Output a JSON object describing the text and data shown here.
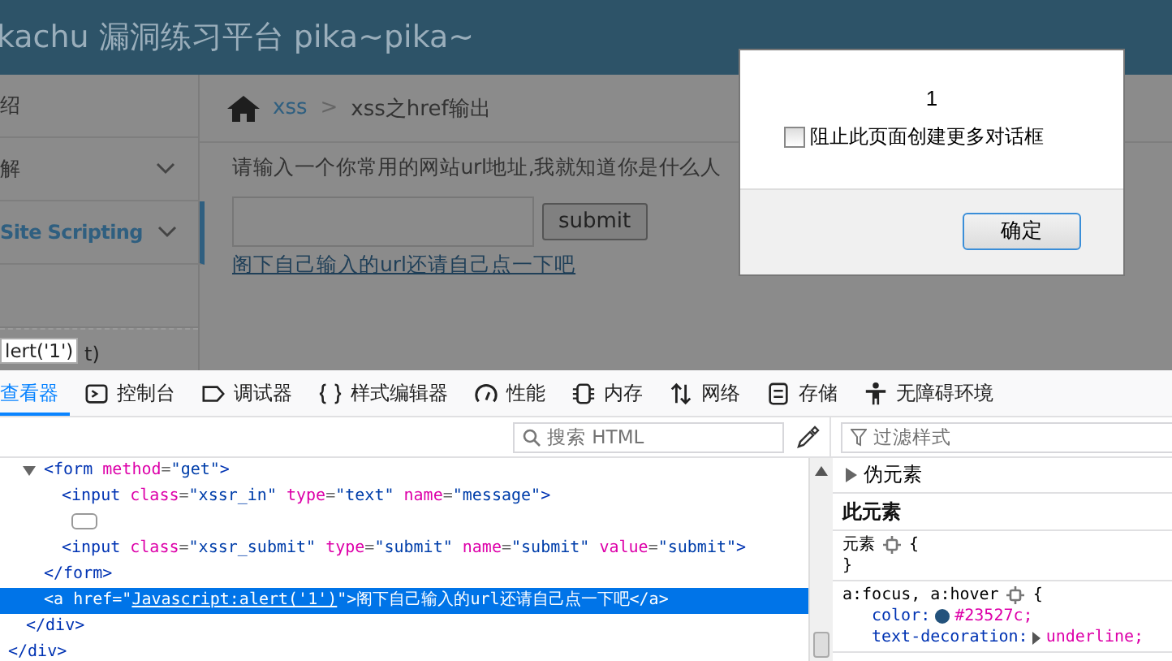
{
  "page": {
    "header_title": "kachu 漏洞练习平台 pika~pika~",
    "sidebar": [
      {
        "label": "绍",
        "kind": "item",
        "selected": false
      },
      {
        "label": "解",
        "kind": "menu",
        "selected": false
      },
      {
        "label": "Site Scripting",
        "kind": "menu",
        "selected": true
      },
      {
        "kind": "item",
        "selected": false
      },
      {
        "label": "t)",
        "kind": "item",
        "selected": false
      }
    ],
    "breadcrumb": {
      "section": "xss",
      "separator": ">",
      "current": "xss之href输出"
    },
    "prompt": "请输入一个你常用的网站url地址,我就知道你是什么人",
    "submit": "submit",
    "link": "阁下自己输入的url还请自己点一下吧"
  },
  "tooltip": "lert('1')",
  "dialog": {
    "message": "1",
    "checkbox": {
      "label": "阻止此页面创建更多对话框",
      "checked": false
    },
    "ok": "确定"
  },
  "devtools": {
    "tabs": [
      {
        "label": "查看器",
        "selected": true
      },
      {
        "label": "控制台",
        "selected": false
      },
      {
        "label": "调试器",
        "selected": false
      },
      {
        "label": "样式编辑器",
        "selected": false
      },
      {
        "label": "性能",
        "selected": false
      },
      {
        "label": "内存",
        "selected": false
      },
      {
        "label": "网络",
        "selected": false
      },
      {
        "label": "存储",
        "selected": false
      },
      {
        "label": "无障碍环境",
        "selected": false
      }
    ],
    "search": {
      "placeholder": "搜索 HTML"
    },
    "filter": {
      "placeholder": "过滤样式"
    },
    "html": [
      {
        "children": [
          {
            "children": [
              {
                "expanded": true,
                "selected": false,
                "tokens": [
                  {
                    "kind": "tag",
                    "text": "<form"
                  },
                  {
                    "kind": "attr",
                    "text": " method"
                  },
                  {
                    "kind": "punct",
                    "text": "="
                  },
                  {
                    "kind": "value",
                    "text": "\"get\""
                  },
                  {
                    "kind": "tag",
                    "text": ">"
                  }
                ],
                "children": [
                  {
                    "selected": false,
                    "tokens": [
                      {
                        "kind": "tag",
                        "text": "<input"
                      },
                      {
                        "kind": "attr",
                        "text": " class"
                      },
                      {
                        "kind": "punct",
                        "text": "="
                      },
                      {
                        "kind": "value",
                        "text": "\"xssr_in\""
                      },
                      {
                        "kind": "attr",
                        "text": " type"
                      },
                      {
                        "kind": "punct",
                        "text": "="
                      },
                      {
                        "kind": "value",
                        "text": "\"text\""
                      },
                      {
                        "kind": "attr",
                        "text": " name"
                      },
                      {
                        "kind": "punct",
                        "text": "="
                      },
                      {
                        "kind": "value",
                        "text": "\"message\""
                      },
                      {
                        "kind": "tag",
                        "text": ">"
                      }
                    ]
                  },
                  {
                    "selected": false,
                    "kind": "whitespace"
                  },
                  {
                    "selected": false,
                    "tokens": [
                      {
                        "kind": "tag",
                        "text": "<input"
                      },
                      {
                        "kind": "attr",
                        "text": " class"
                      },
                      {
                        "kind": "punct",
                        "text": "="
                      },
                      {
                        "kind": "value",
                        "text": "\"xssr_submit\""
                      },
                      {
                        "kind": "attr",
                        "text": " type"
                      },
                      {
                        "kind": "punct",
                        "text": "="
                      },
                      {
                        "kind": "value",
                        "text": "\"submit\""
                      },
                      {
                        "kind": "attr",
                        "text": " name"
                      },
                      {
                        "kind": "punct",
                        "text": "="
                      },
                      {
                        "kind": "value",
                        "text": "\"submit\""
                      },
                      {
                        "kind": "attr",
                        "text": " value"
                      },
                      {
                        "kind": "punct",
                        "text": "="
                      },
                      {
                        "kind": "value",
                        "text": "\"submit\""
                      },
                      {
                        "kind": "tag",
                        "text": ">"
                      }
                    ]
                  }
                ]
              },
              {
                "selected": false,
                "tokens": [
                  {
                    "kind": "tag",
                    "text": "</form>"
                  }
                ]
              },
              {
                "selected": true,
                "tokens": [
                  {
                    "kind": "tag",
                    "text": "<a"
                  },
                  {
                    "kind": "attr",
                    "text": " href"
                  },
                  {
                    "kind": "punct",
                    "text": "=\""
                  },
                  {
                    "kind": "link",
                    "text": "Javascript:alert('1')"
                  },
                  {
                    "kind": "punct",
                    "text": "\""
                  },
                  {
                    "kind": "tag",
                    "text": ">"
                  },
                  {
                    "kind": "text",
                    "text": "阁下自己输入的url还请自己点一下吧"
                  },
                  {
                    "kind": "tag",
                    "text": "</a>"
                  }
                ]
              }
            ]
          },
          {
            "selected": false,
            "tokens": [
              {
                "kind": "tag",
                "text": "</div>"
              }
            ]
          }
        ]
      },
      {
        "selected": false,
        "tokens": [
          {
            "kind": "tag",
            "text": "</div>"
          }
        ]
      }
    ],
    "rules": {
      "pseudo": {
        "label": "伪元素",
        "expanded": false
      },
      "this_element": "此元素",
      "blocks": [
        {
          "selector": "元素",
          "open": "{",
          "close": "}"
        },
        {
          "selector": "a:focus, a:hover",
          "open": "{",
          "declarations": [
            {
              "property": "color:",
              "value": "#23527c;",
              "color": "#23527c"
            },
            {
              "property": "text-decoration:",
              "value": "underline;",
              "expandable": true
            }
          ]
        }
      ]
    }
  }
}
